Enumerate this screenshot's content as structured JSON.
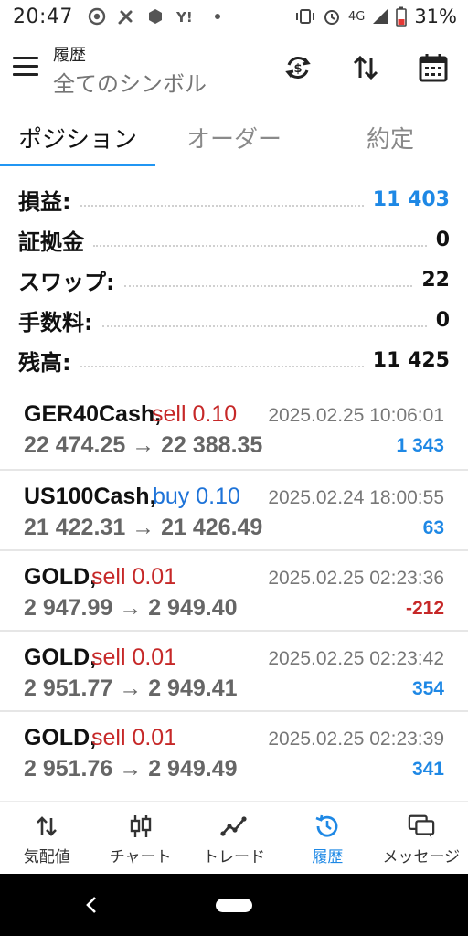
{
  "status_bar": {
    "time": "20:47",
    "network": "4G",
    "battery": "31%"
  },
  "header": {
    "title": "履歴",
    "subtitle": "全てのシンボル",
    "icons": [
      "menu-icon",
      "sync-icon",
      "sort-icon",
      "calendar-icon"
    ]
  },
  "tabs": [
    {
      "label": "ポジション",
      "active": true
    },
    {
      "label": "オーダー",
      "active": false
    },
    {
      "label": "約定",
      "active": false
    }
  ],
  "summary": [
    {
      "label": "損益:",
      "value": "11 403"
    },
    {
      "label": "証拠金",
      "value": "0"
    },
    {
      "label": "スワップ:",
      "value": "22"
    },
    {
      "label": "手数料:",
      "value": "0"
    },
    {
      "label": "残高:",
      "value": "11 425"
    }
  ],
  "deals": [
    {
      "symbol": "GER40Cash,",
      "side": "sell 0.10",
      "time": "2025.02.25 10:06:01",
      "prices": "22 474.25 → 22 388.35",
      "profit": "1 343"
    },
    {
      "symbol": "US100Cash,",
      "side": "buy 0.10",
      "time": "2025.02.24 18:00:55",
      "prices": "21 422.31 → 21 426.49",
      "profit": "63"
    },
    {
      "symbol": "GOLD,",
      "side": "sell 0.01",
      "time": "2025.02.25 02:23:36",
      "prices": "2 947.99 → 2 949.40",
      "profit": "-212"
    },
    {
      "symbol": "GOLD,",
      "side": "sell 0.01",
      "time": "2025.02.25 02:23:42",
      "prices": "2 951.77 → 2 949.41",
      "profit": "354"
    },
    {
      "symbol": "GOLD,",
      "side": "sell 0.01",
      "time": "2025.02.25 02:23:39",
      "prices": "2 951.76 → 2 949.49",
      "profit": "341"
    }
  ],
  "bottom_nav": [
    {
      "label": "気配値",
      "icon": "quotes-icon",
      "active": false
    },
    {
      "label": "チャート",
      "icon": "candlestick-icon",
      "active": false
    },
    {
      "label": "トレード",
      "icon": "trade-icon",
      "active": false
    },
    {
      "label": "履歴",
      "icon": "history-icon",
      "active": true
    },
    {
      "label": "メッセージ",
      "icon": "messages-icon",
      "active": false
    }
  ],
  "colors": {
    "accent": "#2196f3",
    "profit": "#1e88e5",
    "loss": "#c62828",
    "buy": "#1e73d8"
  }
}
